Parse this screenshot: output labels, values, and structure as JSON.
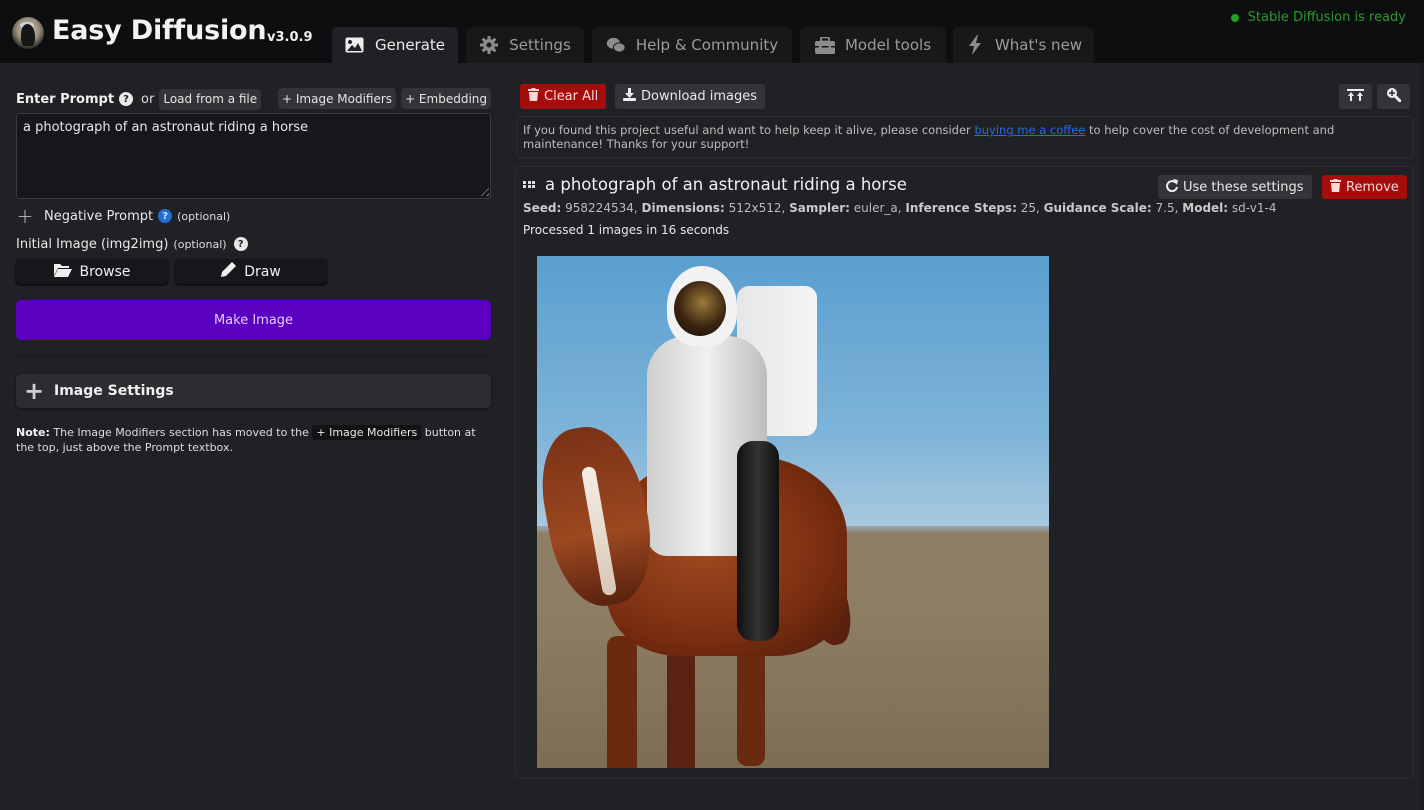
{
  "header": {
    "app_title": "Easy Diffusion",
    "version": "v3.0.9",
    "status_text": "Stable Diffusion is ready",
    "status_color": "#22a022",
    "tabs": [
      {
        "label": "Generate",
        "icon": "image-icon",
        "active": true
      },
      {
        "label": "Settings",
        "icon": "gear-icon",
        "active": false
      },
      {
        "label": "Help & Community",
        "icon": "comments-icon",
        "active": false
      },
      {
        "label": "Model tools",
        "icon": "toolbox-icon",
        "active": false
      },
      {
        "label": "What's new",
        "icon": "bolt-icon",
        "active": false
      }
    ]
  },
  "left": {
    "prompt_label": "Enter Prompt",
    "or_text": "or",
    "load_file_label": "Load from a file",
    "image_modifiers_label": "+ Image Modifiers",
    "embedding_label": "+ Embedding",
    "prompt_value": "a photograph of an astronaut riding a horse",
    "negative_prompt_label": "Negative Prompt",
    "optional_text": "(optional)",
    "initial_image_label": "Initial Image (img2img)",
    "browse_label": "Browse",
    "draw_label": "Draw",
    "make_image_label": "Make Image",
    "make_image_color": "#5a00c0",
    "image_settings_label": "Image Settings",
    "note_prefix": "Note:",
    "note_text_1": "The Image Modifiers section has moved to the",
    "note_pill": "+ Image Modifiers",
    "note_text_2": "button at the top, just above the Prompt textbox."
  },
  "right": {
    "clear_all_label": "Clear All",
    "download_label": "Download images",
    "support_text_1": "If you found this project useful and want to help keep it alive, please consider",
    "support_link": "buying me a coffee",
    "support_text_2": "to help cover the cost of development and maintenance! Thanks for your support!",
    "task": {
      "title": "a photograph of an astronaut riding a horse",
      "use_settings_label": "Use these settings",
      "remove_label": "Remove",
      "meta": [
        {
          "key": "Seed:",
          "value": "958224534"
        },
        {
          "key": "Dimensions:",
          "value": "512x512"
        },
        {
          "key": "Sampler:",
          "value": "euler_a"
        },
        {
          "key": "Inference Steps:",
          "value": "25"
        },
        {
          "key": "Guidance Scale:",
          "value": "7.5"
        },
        {
          "key": "Model:",
          "value": "sd-v1-4"
        }
      ],
      "processed_text": "Processed 1 images in 16 seconds",
      "image_alt": "astronaut riding a horse on a beach"
    }
  }
}
